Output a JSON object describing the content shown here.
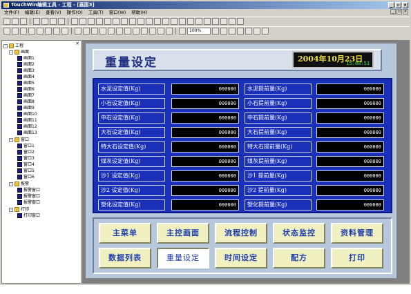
{
  "window": {
    "title": "TouchWin编辑工具 - 工程 - [画面3]",
    "controls": [
      "_",
      "▫",
      "×"
    ],
    "mdi_controls": [
      "_",
      "▫",
      "×"
    ]
  },
  "menubar": [
    "文件(F)",
    "编辑(E)",
    "查看(V)",
    "操作(O)",
    "工具(T)",
    "窗口(W)",
    "帮助(H)"
  ],
  "toolbar": {
    "zoom": "100%"
  },
  "tree": {
    "root": "工程",
    "groups": [
      {
        "label": "画面",
        "items": [
          "画面1",
          "画面2",
          "画面3",
          "画面4",
          "画面5",
          "画面6",
          "画面7",
          "画面8",
          "画面9",
          "画面10",
          "画面11",
          "画面12",
          "画面13"
        ]
      },
      {
        "label": "窗口",
        "items": [
          "窗口1",
          "窗口2",
          "窗口3",
          "窗口4",
          "窗口5",
          "窗口6"
        ]
      },
      {
        "label": "报警",
        "items": [
          "报警窗口",
          "报警窗口",
          "报警窗口"
        ]
      },
      {
        "label": "打印",
        "items": [
          "打印窗口"
        ]
      }
    ]
  },
  "screen": {
    "title": "重量设定",
    "date": "2004年10月23日",
    "time": "15:08:53",
    "rows": [
      {
        "label1": "水泥设定值(Kg)",
        "value1": "000000",
        "label2": "水泥提前量(Kg)",
        "value2": "000000"
      },
      {
        "label1": "小石设定值(Kg)",
        "value1": "000000",
        "label2": "小石提前量(Kg)",
        "value2": "000000"
      },
      {
        "label1": "中石设定值(Kg)",
        "value1": "000000",
        "label2": "中石提前量(Kg)",
        "value2": "000000"
      },
      {
        "label1": "大石设定值(Kg)",
        "value1": "000000",
        "label2": "大石提前量(Kg)",
        "value2": "000000"
      },
      {
        "label1": "特大石设定值(Kg)",
        "value1": "000000",
        "label2": "特大石提前量(Kg)",
        "value2": "000000"
      },
      {
        "label1": "煤灰设定值(Kg)",
        "value1": "000000",
        "label2": "煤灰提前量(Kg)",
        "value2": "000000"
      },
      {
        "label1": "沙1 设定值(Kg)",
        "value1": "000000",
        "label2": "沙1 提前量(Kg)",
        "value2": "000000"
      },
      {
        "label1": "沙2 设定值(Kg)",
        "value1": "000000",
        "label2": "沙2 提前量(Kg)",
        "value2": "000000"
      },
      {
        "label1": "塑化设定值(Kg)",
        "value1": "000000",
        "label2": "塑化提前量(Kg)",
        "value2": "000000"
      }
    ],
    "buttons": {
      "main_menu": "主菜单",
      "main_control": "主控画面",
      "process_control": "流程控制",
      "status_monitor": "状态监控",
      "data_management": "资料管理",
      "data_list": "数据列表",
      "weight_setting": "重量设定",
      "time_setting": "时间设定",
      "recipe": "配方",
      "print": "打印"
    }
  }
}
